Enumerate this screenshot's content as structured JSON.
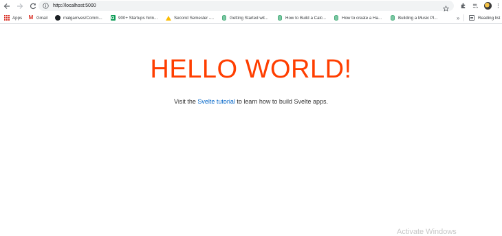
{
  "toolbar": {
    "url": "http://localhost:5000"
  },
  "bookmarks": [
    {
      "label": "Apps",
      "icon": "apps-grid-icon"
    },
    {
      "label": "Gmail",
      "icon": "gmail-icon"
    },
    {
      "label": "malgamves/Comm...",
      "icon": "github-icon"
    },
    {
      "label": "900+ Startups hirin...",
      "icon": "sheets-icon"
    },
    {
      "label": "Second Semester -...",
      "icon": "drive-icon"
    },
    {
      "label": "Getting Started wit...",
      "icon": "database-icon"
    },
    {
      "label": "How to Build a Calc...",
      "icon": "database-icon"
    },
    {
      "label": "How to create a Ha...",
      "icon": "database-icon"
    },
    {
      "label": "Building a Music Pl...",
      "icon": "database-icon"
    }
  ],
  "bookmarks_overflow": "»",
  "reading_list": "Reading list",
  "content": {
    "heading": "HELLO WORLD!",
    "intro_before": "Visit the ",
    "intro_link": "Svelte tutorial",
    "intro_after": " to learn how to build Svelte apps."
  },
  "watermark": "Activate Windows",
  "colors": {
    "heading": "#ff3e00",
    "link": "#0064c8"
  }
}
